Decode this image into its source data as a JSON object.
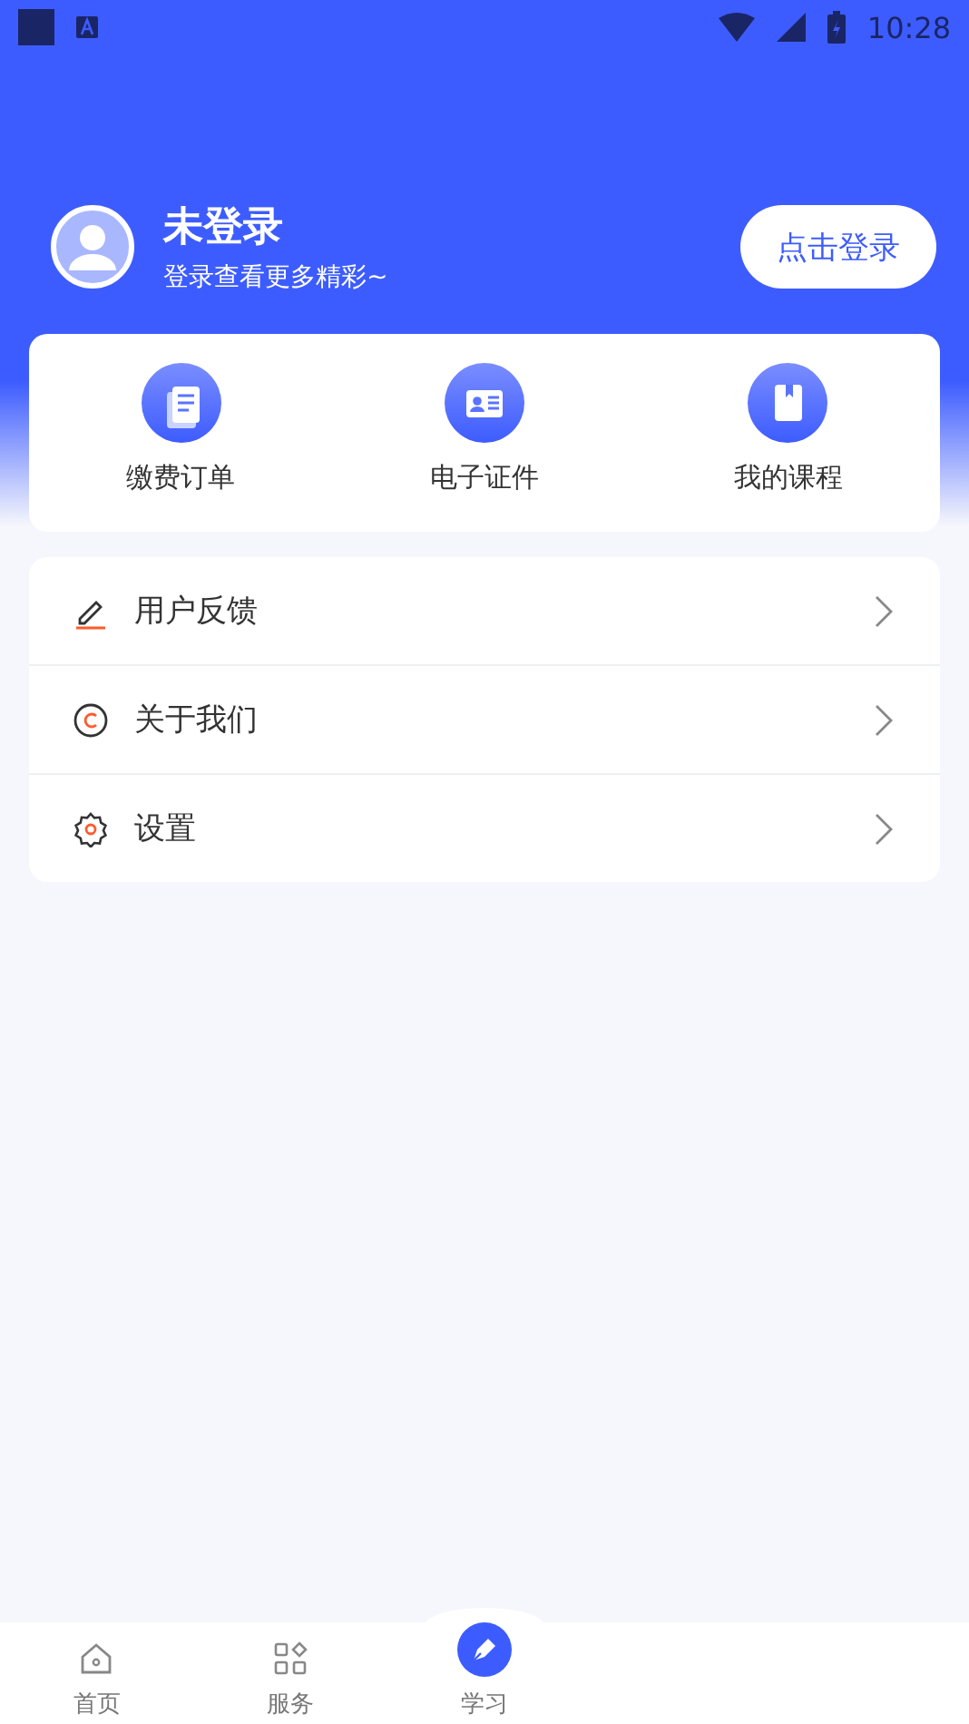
{
  "status_bar": {
    "time": "10:28"
  },
  "profile": {
    "name": "未登录",
    "subtitle": "登录查看更多精彩~",
    "login_button": "点击登录"
  },
  "shortcuts": [
    {
      "label": "缴费订单",
      "kind": "order"
    },
    {
      "label": "电子证件",
      "kind": "card"
    },
    {
      "label": "我的课程",
      "kind": "book"
    }
  ],
  "menu": [
    {
      "label": "用户反馈",
      "kind": "feedback"
    },
    {
      "label": "关于我们",
      "kind": "about"
    },
    {
      "label": "设置",
      "kind": "settings"
    }
  ],
  "tab_bar": [
    {
      "label": "首页",
      "kind": "home",
      "selected": false
    },
    {
      "label": "服务",
      "kind": "service",
      "selected": false
    },
    {
      "label": "学习",
      "kind": "study",
      "selected": false
    }
  ]
}
